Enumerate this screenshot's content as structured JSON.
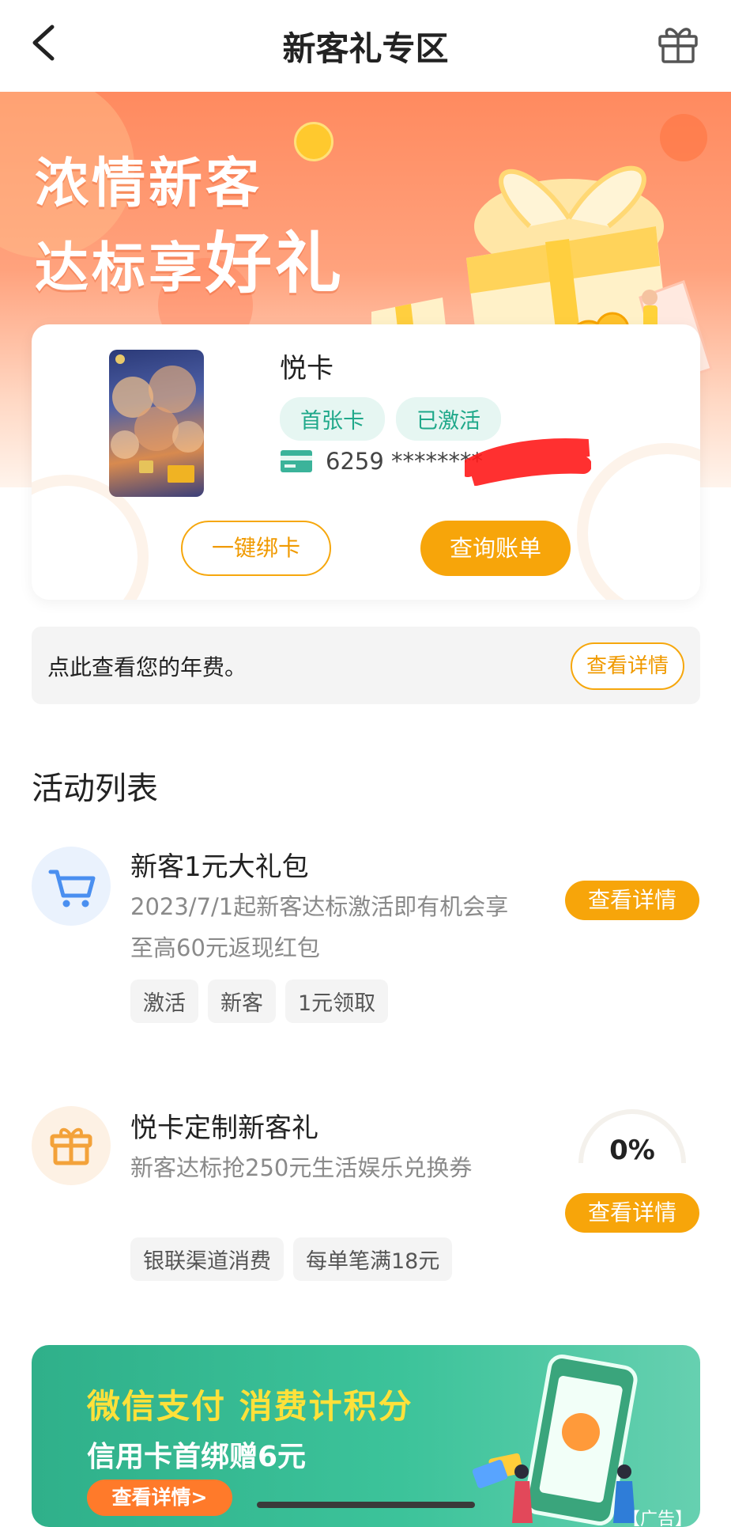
{
  "header": {
    "title": "新客礼专区",
    "back_icon": "chevron-left-icon",
    "gift_icon": "gift-icon"
  },
  "banner": {
    "line1": "浓情新客",
    "line2_prefix": "达标享",
    "line2_emphasis": "好礼"
  },
  "card": {
    "name": "悦卡",
    "tags": [
      "首张卡",
      "已激活"
    ],
    "number_masked": "6259 ********",
    "bind_button": "一键绑卡",
    "bill_button": "查询账单"
  },
  "fee": {
    "text": "点此查看您的年费。",
    "button": "查看详情"
  },
  "activities": {
    "section_title": "活动列表",
    "items": [
      {
        "title": "新客1元大礼包",
        "desc": "2023/7/1起新客达标激活即有机会享至高60元返现红包",
        "tags": [
          "激活",
          "新客",
          "1元领取"
        ],
        "button": "查看详情",
        "icon": "cart-icon"
      },
      {
        "title": "悦卡定制新客礼",
        "desc": "新客达标抢250元生活娱乐兑换券",
        "tags": [
          "银联渠道消费",
          "每单笔满18元"
        ],
        "button": "查看详情",
        "progress": "0%",
        "icon": "gift-icon"
      }
    ]
  },
  "promo": {
    "line1": "微信支付 消费计积分",
    "line2": "信用卡首绑赠6元",
    "button": "查看详情>",
    "ad_label": "【广告】"
  },
  "colors": {
    "accent_orange": "#f7a50a",
    "tag_green": "#1fa88a",
    "banner_orange": "#ff8a5f",
    "promo_green": "#3cc39a"
  }
}
